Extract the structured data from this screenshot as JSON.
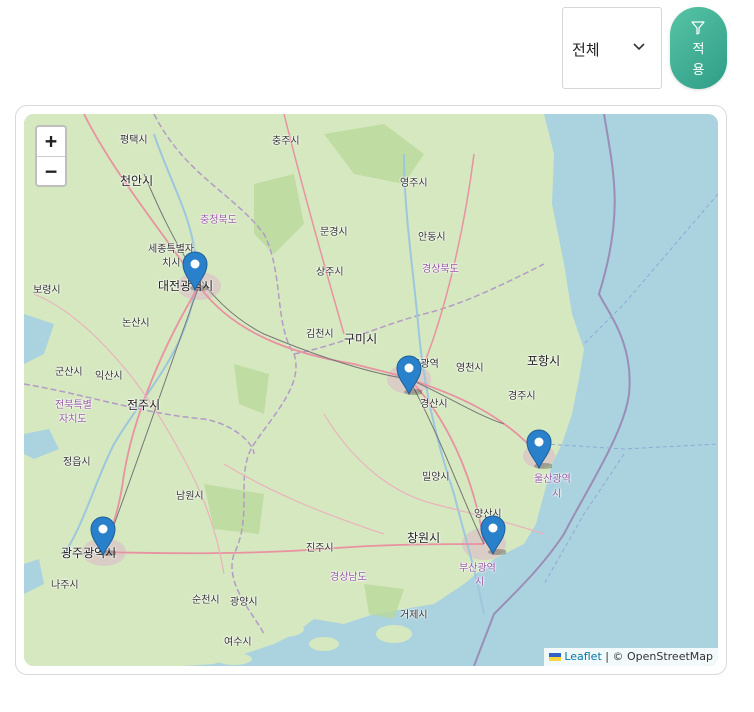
{
  "filter": {
    "selected": "전체",
    "apply_label_1": "적",
    "apply_label_2": "용"
  },
  "map": {
    "zoom_in": "+",
    "zoom_out": "−",
    "attribution": {
      "leaflet": "Leaflet",
      "separator": " | © ",
      "osm": "OpenStreetMap"
    },
    "places": {
      "pyeongtaek": "평택시",
      "cheonan": "천안시",
      "chungju": "충주시",
      "yeongju": "영주시",
      "chungbuk": "충청북도",
      "sejong_1": "세종특별자",
      "sejong_2": "치시",
      "daejeon": "대전광역시",
      "munkyeong": "문경시",
      "andong": "안동시",
      "gyeongbuk": "경상북도",
      "boryeong": "보령시",
      "sangju": "상주시",
      "nonsan": "논산시",
      "gimcheon": "김천시",
      "gumi": "구미시",
      "daegu": "대구광역",
      "pohang": "포항시",
      "gunsan": "군산시",
      "iksan": "익산시",
      "yeongcheon": "영천시",
      "gyeongju": "경주시",
      "jeonbuk_1": "전북특별",
      "jeonbuk_2": "자치도",
      "jeonju": "전주시",
      "gyeongsan": "경산시",
      "jeongeup": "정읍시",
      "miryang": "밀양시",
      "ulsan_1": "울산광역",
      "ulsan_2": "시",
      "namwon": "남원시",
      "yangsan": "양산시",
      "gwangju": "광주광역시",
      "jinju": "진주시",
      "changwon": "창원시",
      "busan_1": "부산광역",
      "busan_2": "시",
      "naju": "나주시",
      "gyeongnam": "경상남도",
      "suncheon": "순천시",
      "gwangyang": "광양시",
      "geoje": "거제시",
      "yeosu": "여수시"
    },
    "markers": [
      "daejeon-marker",
      "daegu-marker",
      "ulsan-marker",
      "busan-marker",
      "gwangju-marker"
    ]
  }
}
